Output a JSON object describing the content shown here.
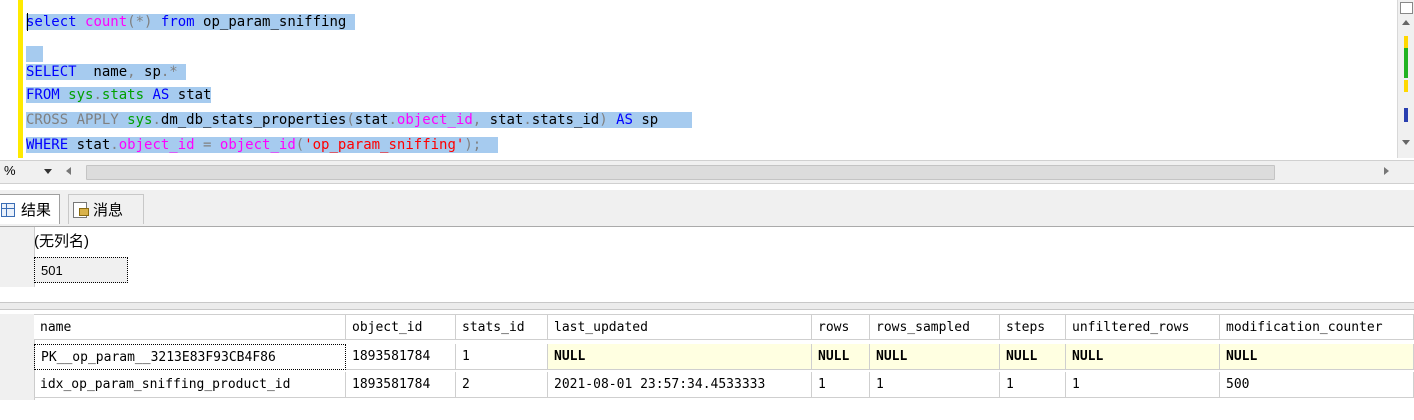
{
  "editor": {
    "lines": [
      {
        "parts": [
          {
            "t": "select ",
            "c": "kw"
          },
          {
            "t": "count",
            "c": "fn"
          },
          {
            "t": "(*) ",
            "c": "gray"
          },
          {
            "t": "from",
            "c": "kw"
          },
          {
            "t": " op_param_sniffing ",
            "c": "txt"
          }
        ]
      },
      {
        "parts": [
          {
            "t": "  ",
            "c": "txt"
          }
        ]
      },
      {
        "parts": [
          {
            "t": "SELECT",
            "c": "kw"
          },
          {
            "t": "  name",
            "c": "txt"
          },
          {
            "t": ", ",
            "c": "gray"
          },
          {
            "t": "sp",
            "c": "txt"
          },
          {
            "t": ".*",
            "c": "gray"
          },
          {
            "t": " ",
            "c": "txt"
          }
        ]
      },
      {
        "parts": [
          {
            "t": "FROM ",
            "c": "kw"
          },
          {
            "t": "sys",
            "c": "sys"
          },
          {
            "t": ".",
            "c": "gray"
          },
          {
            "t": "stats",
            "c": "sys"
          },
          {
            "t": " AS ",
            "c": "kw"
          },
          {
            "t": "stat",
            "c": "txt"
          }
        ]
      },
      {
        "parts": [
          {
            "t": "CROSS APPLY ",
            "c": "gray"
          },
          {
            "t": "sys",
            "c": "sys"
          },
          {
            "t": ".",
            "c": "gray"
          },
          {
            "t": "dm_db_stats_properties",
            "c": "txt"
          },
          {
            "t": "(",
            "c": "gray"
          },
          {
            "t": "stat",
            "c": "txt"
          },
          {
            "t": ".",
            "c": "gray"
          },
          {
            "t": "object_id",
            "c": "fn"
          },
          {
            "t": ", ",
            "c": "gray"
          },
          {
            "t": "stat",
            "c": "txt"
          },
          {
            "t": ".",
            "c": "gray"
          },
          {
            "t": "stats_id",
            "c": "txt"
          },
          {
            "t": ") ",
            "c": "gray"
          },
          {
            "t": "AS",
            "c": "kw"
          },
          {
            "t": " sp    ",
            "c": "txt"
          }
        ]
      },
      {
        "parts": [
          {
            "t": "WHERE ",
            "c": "kw"
          },
          {
            "t": "stat",
            "c": "txt"
          },
          {
            "t": ".",
            "c": "gray"
          },
          {
            "t": "object_id",
            "c": "fn"
          },
          {
            "t": " = ",
            "c": "gray"
          },
          {
            "t": "object_id",
            "c": "fn"
          },
          {
            "t": "(",
            "c": "gray"
          },
          {
            "t": "'op_param_sniffing'",
            "c": "str"
          },
          {
            "t": ");  ",
            "c": "gray"
          }
        ]
      }
    ]
  },
  "zoom": {
    "label": "%"
  },
  "tabs": {
    "results": "结果",
    "messages": "消息"
  },
  "grid1": {
    "header": "(无列名)",
    "value": "501"
  },
  "grid2": {
    "columns": [
      "name",
      "object_id",
      "stats_id",
      "last_updated",
      "rows",
      "rows_sampled",
      "steps",
      "unfiltered_rows",
      "modification_counter"
    ],
    "rows": [
      {
        "num": "",
        "cells": [
          "PK__op_param__3213E83F93CB4F86",
          "1893581784",
          "1",
          "NULL",
          "NULL",
          "NULL",
          "NULL",
          "NULL",
          "NULL"
        ]
      },
      {
        "num": "",
        "cells": [
          "idx_op_param_sniffing_product_id",
          "1893581784",
          "2",
          "2021-08-01 23:57:34.4533333",
          "1",
          "1",
          "1",
          "1",
          "500"
        ]
      }
    ]
  },
  "colors": {
    "selection": "#a6cbef",
    "keyword": "#0000ff",
    "function": "#ff00ff",
    "sysobj": "#00a000",
    "string": "#ff0000",
    "null_bg": "#ffffe1"
  }
}
